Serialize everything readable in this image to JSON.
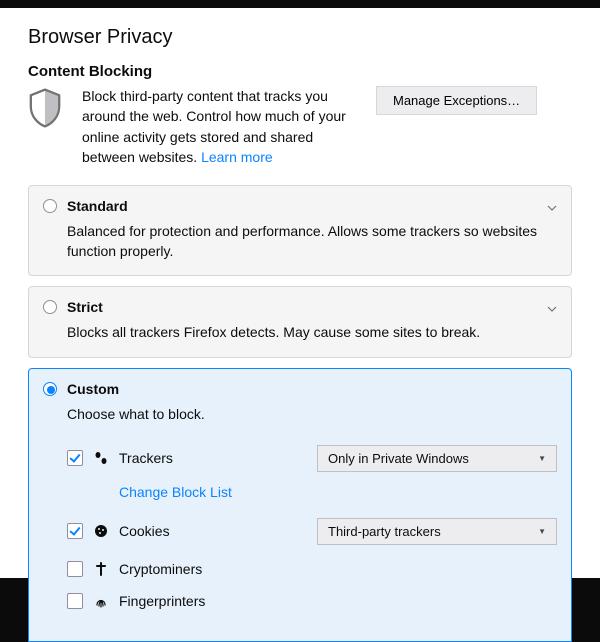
{
  "title": "Browser Privacy",
  "sectionTitle": "Content Blocking",
  "intro": "Block third-party content that tracks you around the web. Control how much of your online activity gets stored and shared between websites. ",
  "learnMore": "Learn more",
  "manageExceptions": "Manage Exceptions…",
  "options": {
    "standard": {
      "label": "Standard",
      "desc": "Balanced for protection and performance. Allows some trackers so websites function properly.",
      "selected": false
    },
    "strict": {
      "label": "Strict",
      "desc": "Blocks all trackers Firefox detects. May cause some sites to break.",
      "selected": false
    },
    "custom": {
      "label": "Custom",
      "desc": "Choose what to block.",
      "selected": true
    }
  },
  "custom": {
    "trackers": {
      "label": "Trackers",
      "checked": true,
      "selectValue": "Only in Private Windows",
      "changeListLabel": "Change Block List"
    },
    "cookies": {
      "label": "Cookies",
      "checked": true,
      "selectValue": "Third-party trackers"
    },
    "cryptominers": {
      "label": "Cryptominers",
      "checked": false
    },
    "fingerprinters": {
      "label": "Fingerprinters",
      "checked": false
    }
  }
}
